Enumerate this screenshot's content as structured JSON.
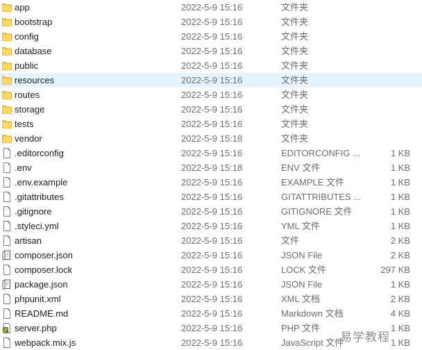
{
  "columns": [
    "name",
    "date",
    "type",
    "size"
  ],
  "colors": {
    "selected_row_bg": "#e5f3ff",
    "folder_yellow": "#ffd45a",
    "secondary_text": "#6d6d6d"
  },
  "files": [
    {
      "name": "app",
      "date": "2022-5-9 15:16",
      "type": "文件夹",
      "size": "",
      "icon": "folder-icon"
    },
    {
      "name": "bootstrap",
      "date": "2022-5-9 15:16",
      "type": "文件夹",
      "size": "",
      "icon": "folder-icon"
    },
    {
      "name": "config",
      "date": "2022-5-9 15:16",
      "type": "文件夹",
      "size": "",
      "icon": "folder-icon"
    },
    {
      "name": "database",
      "date": "2022-5-9 15:16",
      "type": "文件夹",
      "size": "",
      "icon": "folder-icon"
    },
    {
      "name": "public",
      "date": "2022-5-9 15:16",
      "type": "文件夹",
      "size": "",
      "icon": "folder-icon"
    },
    {
      "name": "resources",
      "date": "2022-5-9 15:16",
      "type": "文件夹",
      "size": "",
      "icon": "folder-icon",
      "selected": true
    },
    {
      "name": "routes",
      "date": "2022-5-9 15:16",
      "type": "文件夹",
      "size": "",
      "icon": "folder-icon"
    },
    {
      "name": "storage",
      "date": "2022-5-9 15:16",
      "type": "文件夹",
      "size": "",
      "icon": "folder-icon"
    },
    {
      "name": "tests",
      "date": "2022-5-9 15:16",
      "type": "文件夹",
      "size": "",
      "icon": "folder-icon"
    },
    {
      "name": "vendor",
      "date": "2022-5-9 15:18",
      "type": "文件夹",
      "size": "",
      "icon": "folder-icon"
    },
    {
      "name": ".editorconfig",
      "date": "2022-5-9 15:16",
      "type": "EDITORCONFIG ...",
      "size": "1 KB",
      "icon": "file-icon"
    },
    {
      "name": ".env",
      "date": "2022-5-9 15:18",
      "type": "ENV 文件",
      "size": "1 KB",
      "icon": "file-icon"
    },
    {
      "name": ".env.example",
      "date": "2022-5-9 15:16",
      "type": "EXAMPLE 文件",
      "size": "1 KB",
      "icon": "file-icon"
    },
    {
      "name": ".gitattributes",
      "date": "2022-5-9 15:16",
      "type": "GITATTRIBUTES ...",
      "size": "1 KB",
      "icon": "file-icon"
    },
    {
      "name": ".gitignore",
      "date": "2022-5-9 15:16",
      "type": "GITIGNORE 文件",
      "size": "1 KB",
      "icon": "file-icon"
    },
    {
      "name": ".styleci.yml",
      "date": "2022-5-9 15:16",
      "type": "YML 文件",
      "size": "1 KB",
      "icon": "file-icon"
    },
    {
      "name": "artisan",
      "date": "2022-5-9 15:16",
      "type": "文件",
      "size": "2 KB",
      "icon": "file-icon"
    },
    {
      "name": "composer.json",
      "date": "2022-5-9 15:16",
      "type": "JSON File",
      "size": "2 KB",
      "icon": "json-file-icon"
    },
    {
      "name": "composer.lock",
      "date": "2022-5-9 15:16",
      "type": "LOCK 文件",
      "size": "297 KB",
      "icon": "file-icon"
    },
    {
      "name": "package.json",
      "date": "2022-5-9 15:16",
      "type": "JSON File",
      "size": "1 KB",
      "icon": "json-file-icon"
    },
    {
      "name": "phpunit.xml",
      "date": "2022-5-9 15:16",
      "type": "XML 文档",
      "size": "2 KB",
      "icon": "file-icon"
    },
    {
      "name": "README.md",
      "date": "2022-5-9 15:16",
      "type": "Markdown 文档",
      "size": "4 KB",
      "icon": "file-icon"
    },
    {
      "name": "server.php",
      "date": "2022-5-9 15:16",
      "type": "PHP 文件",
      "size": "1 KB",
      "icon": "php-file-icon"
    },
    {
      "name": "webpack.mix.js",
      "date": "2022-5-9 15:16",
      "type": "JavaScript 文件",
      "size": "1 KB",
      "icon": "file-icon"
    }
  ],
  "watermark": "易学教程"
}
